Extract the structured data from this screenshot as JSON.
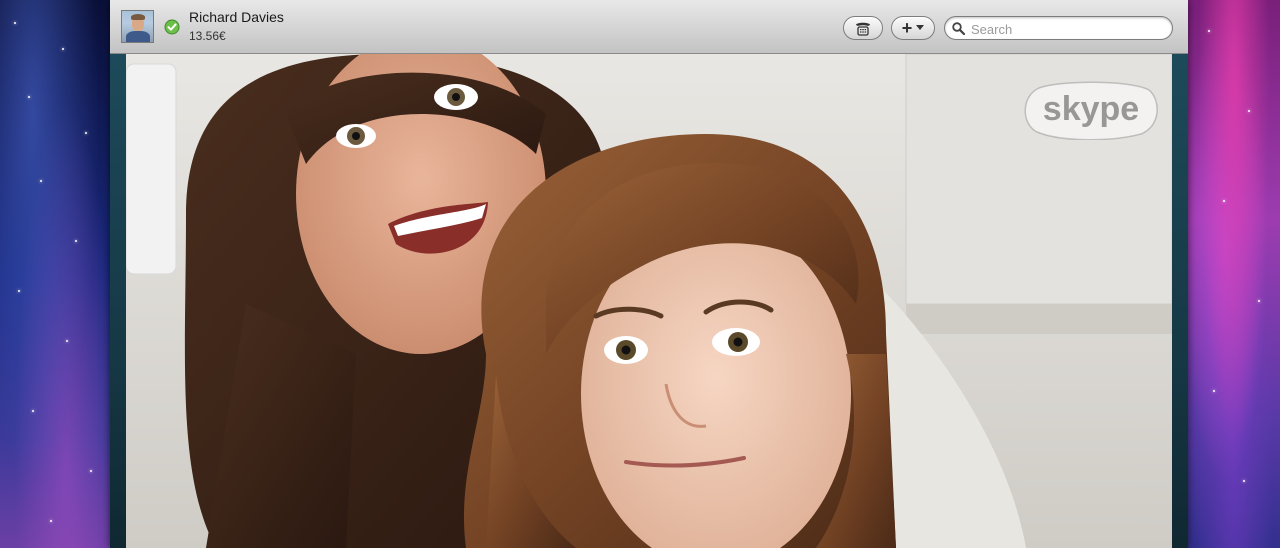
{
  "contact": {
    "name": "Richard Davies",
    "credit": "13.56€",
    "status": "online"
  },
  "toolbar": {
    "dial_icon": "dialpad-icon",
    "add_label": "+",
    "add_icon": "chevron-down-icon"
  },
  "search": {
    "placeholder": "Search",
    "value": ""
  },
  "video": {
    "logo_text": "skype"
  },
  "colors": {
    "status_green": "#6cc04a",
    "titlebar": "#d4d4d4",
    "video_border": "#163845"
  }
}
